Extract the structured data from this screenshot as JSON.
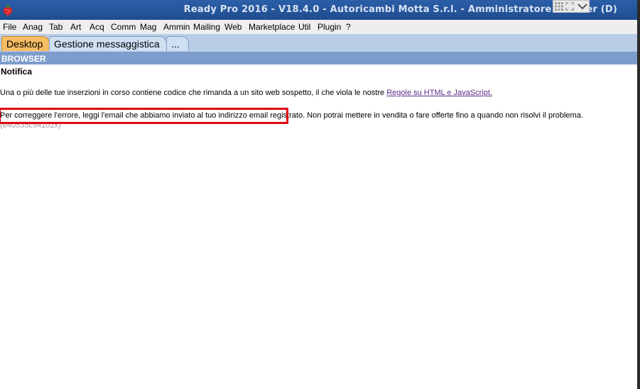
{
  "titlebar": {
    "title": "Ready Pro 2016 - V18.4.0 - Autoricambi Motta S.r.l. - Amministratore - Server (D)",
    "app_icon": "strawberry-icon"
  },
  "overlay_controls": {
    "icons": [
      "grid-icon",
      "expand-icon",
      "chevron-down-icon"
    ]
  },
  "menu": {
    "items": [
      "File",
      "Anag",
      "Tab",
      "Art",
      "Acq",
      "Comm",
      "Mag",
      "Ammin",
      "Mailing",
      "Web",
      "Marketplace",
      "Util",
      "Plugin",
      "?"
    ]
  },
  "tabs": [
    {
      "label": "Desktop",
      "active": true
    },
    {
      "label": "Gestione messaggistica",
      "active": false
    },
    {
      "label": "...",
      "active": false
    }
  ],
  "browser": {
    "header": "BROWSER",
    "notification_title": "Notifica",
    "para1_text": "Una o più delle tue inserzioni in corso contiene codice che rimanda a un sito web sospetto, il che viola le nostre ",
    "para1_link": "Regole su HTML e JavaScript.",
    "para2_highlighted": "Per correggere l'errore, leggi l'email che abbiamo inviato al tuo indirizzo email registrato.",
    "para2_rest": " Non potrai mettere in vendita o fare offerte fino a quando non risolvi il problema.",
    "code": "(e40535c54102x)"
  },
  "colors": {
    "titlebar": "#2c5fa8",
    "tab_active": "#f7bd63",
    "browser_header": "#7d9dcc",
    "highlight_border": "#e0000f",
    "link": "#5a2d82"
  }
}
